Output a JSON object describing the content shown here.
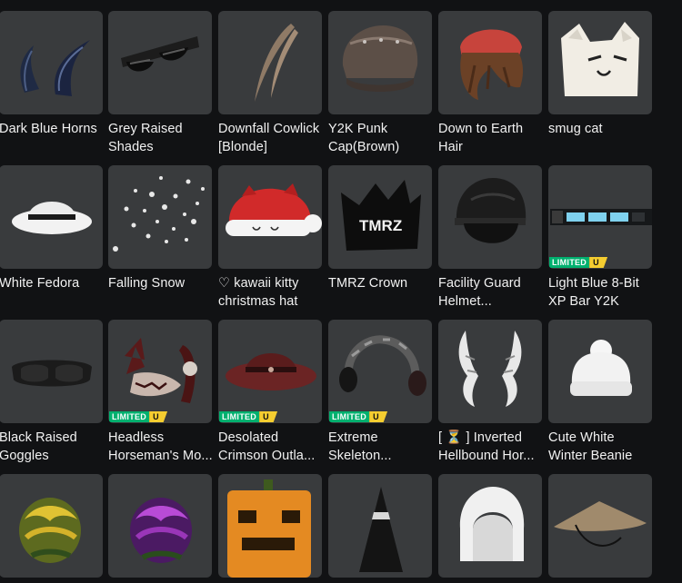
{
  "catalog": {
    "limited_label": "LIMITED",
    "unique_label": "U",
    "items": [
      {
        "name": "Dark Blue Horns",
        "icon": "horns-icon",
        "limited": false
      },
      {
        "name": "Grey Raised\nShades",
        "icon": "sunglasses-icon",
        "limited": false
      },
      {
        "name": "Downfall Cowlick\n[Blonde]",
        "icon": "cowlick-hair-icon",
        "limited": false
      },
      {
        "name": "Y2K Punk\nCap(Brown)",
        "icon": "punk-cap-icon",
        "limited": false
      },
      {
        "name": "Down to Earth\nHair",
        "icon": "beanie-hair-icon",
        "limited": false
      },
      {
        "name": "smug cat",
        "icon": "smug-cat-hat-icon",
        "limited": false
      },
      {
        "name": "White Fedora",
        "icon": "fedora-icon",
        "limited": false
      },
      {
        "name": "Falling Snow",
        "icon": "snow-particles-icon",
        "limited": false
      },
      {
        "name": "♡ kawaii kitty\nchristmas hat",
        "icon": "kitty-santa-hat-icon",
        "limited": false
      },
      {
        "name": "TMRZ Crown",
        "icon": "crown-icon",
        "limited": false
      },
      {
        "name": "Facility Guard\nHelmet...",
        "icon": "helmet-icon",
        "limited": false
      },
      {
        "name": "Light Blue 8-Bit\nXP Bar Y2K",
        "icon": "xp-bar-icon",
        "limited": true
      },
      {
        "name": "Black Raised\nGoggles",
        "icon": "goggles-icon",
        "limited": false
      },
      {
        "name": "Headless\nHorseman's Mo...",
        "icon": "horseman-mask-icon",
        "limited": true
      },
      {
        "name": "Desolated\nCrimson Outla...",
        "icon": "outlaw-hat-icon",
        "limited": true
      },
      {
        "name": "Extreme\nSkeleton...",
        "icon": "skeleton-headphones-icon",
        "limited": true
      },
      {
        "name": "[ ⏳ ] Inverted\nHellbound Hor...",
        "icon": "bone-horns-icon",
        "limited": false
      },
      {
        "name": "Cute White\nWinter Beanie",
        "icon": "white-beanie-icon",
        "limited": false
      },
      {
        "name": "",
        "icon": "yellow-flower-icon",
        "limited": false
      },
      {
        "name": "",
        "icon": "purple-flower-icon",
        "limited": false
      },
      {
        "name": "",
        "icon": "pumpkin-head-icon",
        "limited": false
      },
      {
        "name": "",
        "icon": "witch-hat-icon",
        "limited": false
      },
      {
        "name": "",
        "icon": "white-hood-icon",
        "limited": false
      },
      {
        "name": "",
        "icon": "conical-straw-hat-icon",
        "limited": false
      }
    ]
  }
}
